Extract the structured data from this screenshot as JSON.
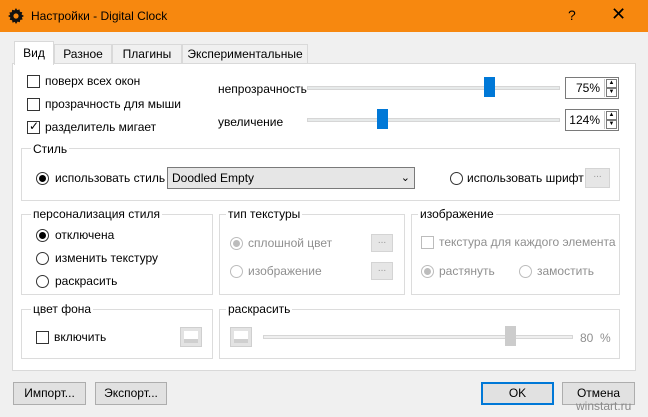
{
  "window": {
    "title": "Настройки - Digital Clock",
    "help": "?",
    "close": "✕",
    "accent": "#f7880f"
  },
  "tabs": [
    {
      "label": "Вид",
      "active": true
    },
    {
      "label": "Разное",
      "active": false
    },
    {
      "label": "Плагины",
      "active": false
    },
    {
      "label": "Экспериментальные",
      "active": false
    }
  ],
  "options": {
    "on_top": {
      "label": "поверх всех окон",
      "checked": false
    },
    "mouse_transparent": {
      "label": "прозрачность для мыши",
      "checked": false
    },
    "blink_separator": {
      "label": "разделитель мигает",
      "checked": true
    }
  },
  "sliders": {
    "opacity": {
      "label": "непрозрачность",
      "value": "75%",
      "level": 0.75
    },
    "zoom": {
      "label": "увеличение",
      "value": "124%",
      "level": 0.24
    }
  },
  "style": {
    "group": "Стиль",
    "use_style": "использовать стиль",
    "selected_skin": "Doodled Empty",
    "use_font": "использовать шрифт",
    "font_button": "..."
  },
  "customize": {
    "group": "персонализация стиля",
    "disabled": "отключена",
    "change_texture": "изменить текстуру",
    "colorize": "раскрасить"
  },
  "texture_type": {
    "group": "тип текстуры",
    "solid": "сплошной цвет",
    "image": "изображение",
    "button": "..."
  },
  "image": {
    "group": "изображение",
    "per_element": "текстура для каждого элемента",
    "stretch": "растянуть",
    "tile": "замостить"
  },
  "background": {
    "group": "цвет фона",
    "enable": "включить"
  },
  "colorize": {
    "group": "раскрасить",
    "value": "80",
    "unit": "%",
    "level": 0.8
  },
  "buttons": {
    "import": "Импорт...",
    "export": "Экспорт...",
    "ok": "OK",
    "cancel": "Отмена"
  },
  "watermark": "winstart.ru"
}
